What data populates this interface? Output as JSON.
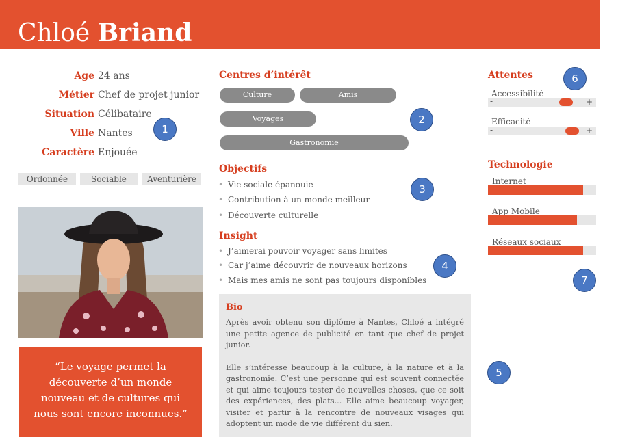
{
  "header": {
    "first_name": "Chloé",
    "last_name": "Briand"
  },
  "profile": {
    "rows": [
      {
        "label": "Age",
        "value": "24 ans"
      },
      {
        "label": "Métier",
        "value": "Chef de projet junior"
      },
      {
        "label": "Situation",
        "value": "Célibataire"
      },
      {
        "label": "Ville",
        "value": "Nantes"
      },
      {
        "label": "Caractère",
        "value": "Enjouée"
      }
    ],
    "traits": [
      "Ordonnée",
      "Sociable",
      "Aventurière"
    ]
  },
  "quote": "“Le voyage permet la découverte d’un monde nouveau et de cultures qui nous sont encore inconnues.”",
  "interests": {
    "title": "Centres d’intérêt",
    "items": [
      "Culture",
      "Amis",
      "Voyages",
      "Gastronomie"
    ]
  },
  "goals": {
    "title": "Objectifs",
    "items": [
      "Vie sociale épanouie",
      "Contribution à un monde meilleur",
      "Découverte culturelle"
    ]
  },
  "insight": {
    "title": "Insight",
    "items": [
      "J’aimerai pouvoir voyager sans limites",
      "Car j’aime découvrir de nouveaux horizons",
      "Mais mes amis ne sont pas toujours disponibles"
    ]
  },
  "bio": {
    "title": "Bio",
    "p1": "Après avoir obtenu son diplôme à Nantes, Chloé a intégré une petite agence de publicité en tant que chef de projet junior.",
    "p2": "Elle s’intéresse beaucoup à la culture, à la nature et à la gastronomie. C’est une personne qui est souvent connectée et qui aime toujours tester de nouvelles choses, que ce soit des expériences, des plats... Elle aime beaucoup voyager, visiter et partir à la rencontre de nouveaux visages qui adoptent un mode de vie différent du sien."
  },
  "expectations": {
    "title": "Attentes",
    "minus": "-",
    "plus": "+",
    "items": [
      {
        "label": "Accessibilité",
        "level": 0.72
      },
      {
        "label": "Efficacité",
        "level": 0.78
      }
    ]
  },
  "technology": {
    "title": "Technologie",
    "items": [
      {
        "label": "Internet",
        "level": 0.88
      },
      {
        "label": "App Mobile",
        "level": 0.82
      },
      {
        "label": "Réseaux sociaux",
        "level": 0.88
      }
    ]
  },
  "markers": [
    "1",
    "2",
    "3",
    "4",
    "5",
    "6",
    "7"
  ],
  "colors": {
    "accent": "#e3512f",
    "label": "#d63e1f",
    "pill": "#8a8a8a",
    "marker": "#4a78c4"
  }
}
